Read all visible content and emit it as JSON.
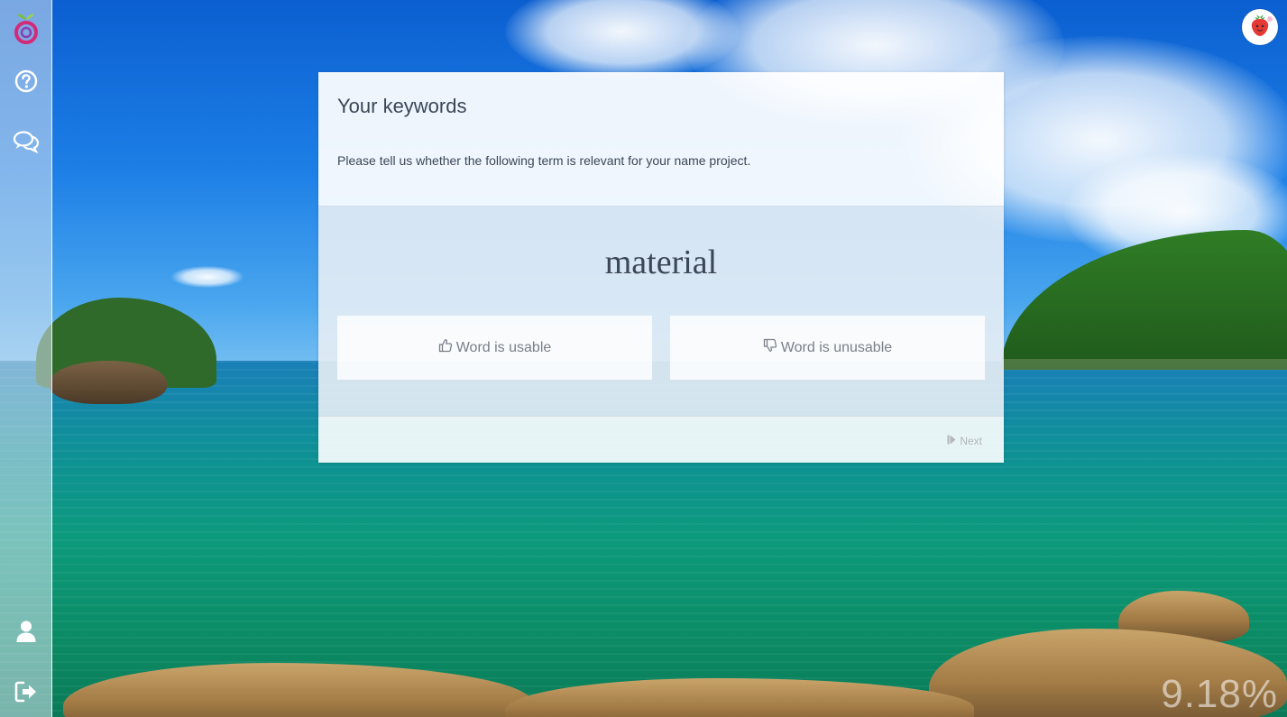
{
  "card": {
    "title": "Your keywords",
    "description": "Please tell us whether the following term is relevant for your name project.",
    "term": "material",
    "usable_label": "Word is usable",
    "unusable_label": "Word is unusable",
    "next_label": "Next"
  },
  "progress": {
    "text": "9.18%",
    "value_percent": 9.18
  },
  "sidebar": {
    "items": [
      {
        "icon": "logo-icon"
      },
      {
        "icon": "help-icon"
      },
      {
        "icon": "chat-icon"
      },
      {
        "icon": "user-icon"
      },
      {
        "icon": "logout-icon"
      }
    ]
  },
  "avatar": {
    "icon": "strawberry-icon"
  },
  "colors": {
    "text": "#3b4656",
    "muted": "#7a8089",
    "sidebar": "#d7e4f0"
  }
}
